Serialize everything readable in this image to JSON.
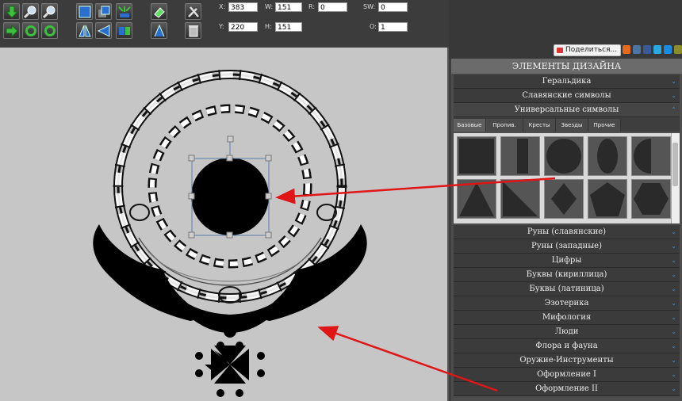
{
  "toolbar": {
    "fields": {
      "x_label": "X:",
      "x_value": "383",
      "w_label": "W:",
      "w_value": "151",
      "r_label": "R:",
      "r_value": "0",
      "sw_label": "SW:",
      "sw_value": "0",
      "y_label": "Y:",
      "y_value": "220",
      "h_label": "H:",
      "h_value": "151",
      "o_label": "O:",
      "o_value": "1"
    }
  },
  "share": {
    "label": "Поделиться..."
  },
  "panel": {
    "title": "ЭЛЕМЕНТЫ ДИЗАЙНА",
    "top_categories": [
      "Геральдика",
      "Славянские символы",
      "Универсальные символы"
    ],
    "tabs": [
      "Базовые",
      "Пропив.",
      "Кресты",
      "Звезды",
      "Прочие"
    ],
    "categories": [
      "Руны (славянские)",
      "Руны (западные)",
      "Цифры",
      "Буквы (кириллица)",
      "Буквы (латиница)",
      "Эзотерика",
      "Мифология",
      "Люди",
      "Флора и фауна",
      "Оружие-Инструменты",
      "Оформление I",
      "Оформление II"
    ],
    "chevron": "⌄"
  },
  "colors": {
    "canvas": "#c6c6c6",
    "panel": "#4d4d4d",
    "accent_chevron": "#4a8fd8",
    "arrow": "#e01515"
  }
}
